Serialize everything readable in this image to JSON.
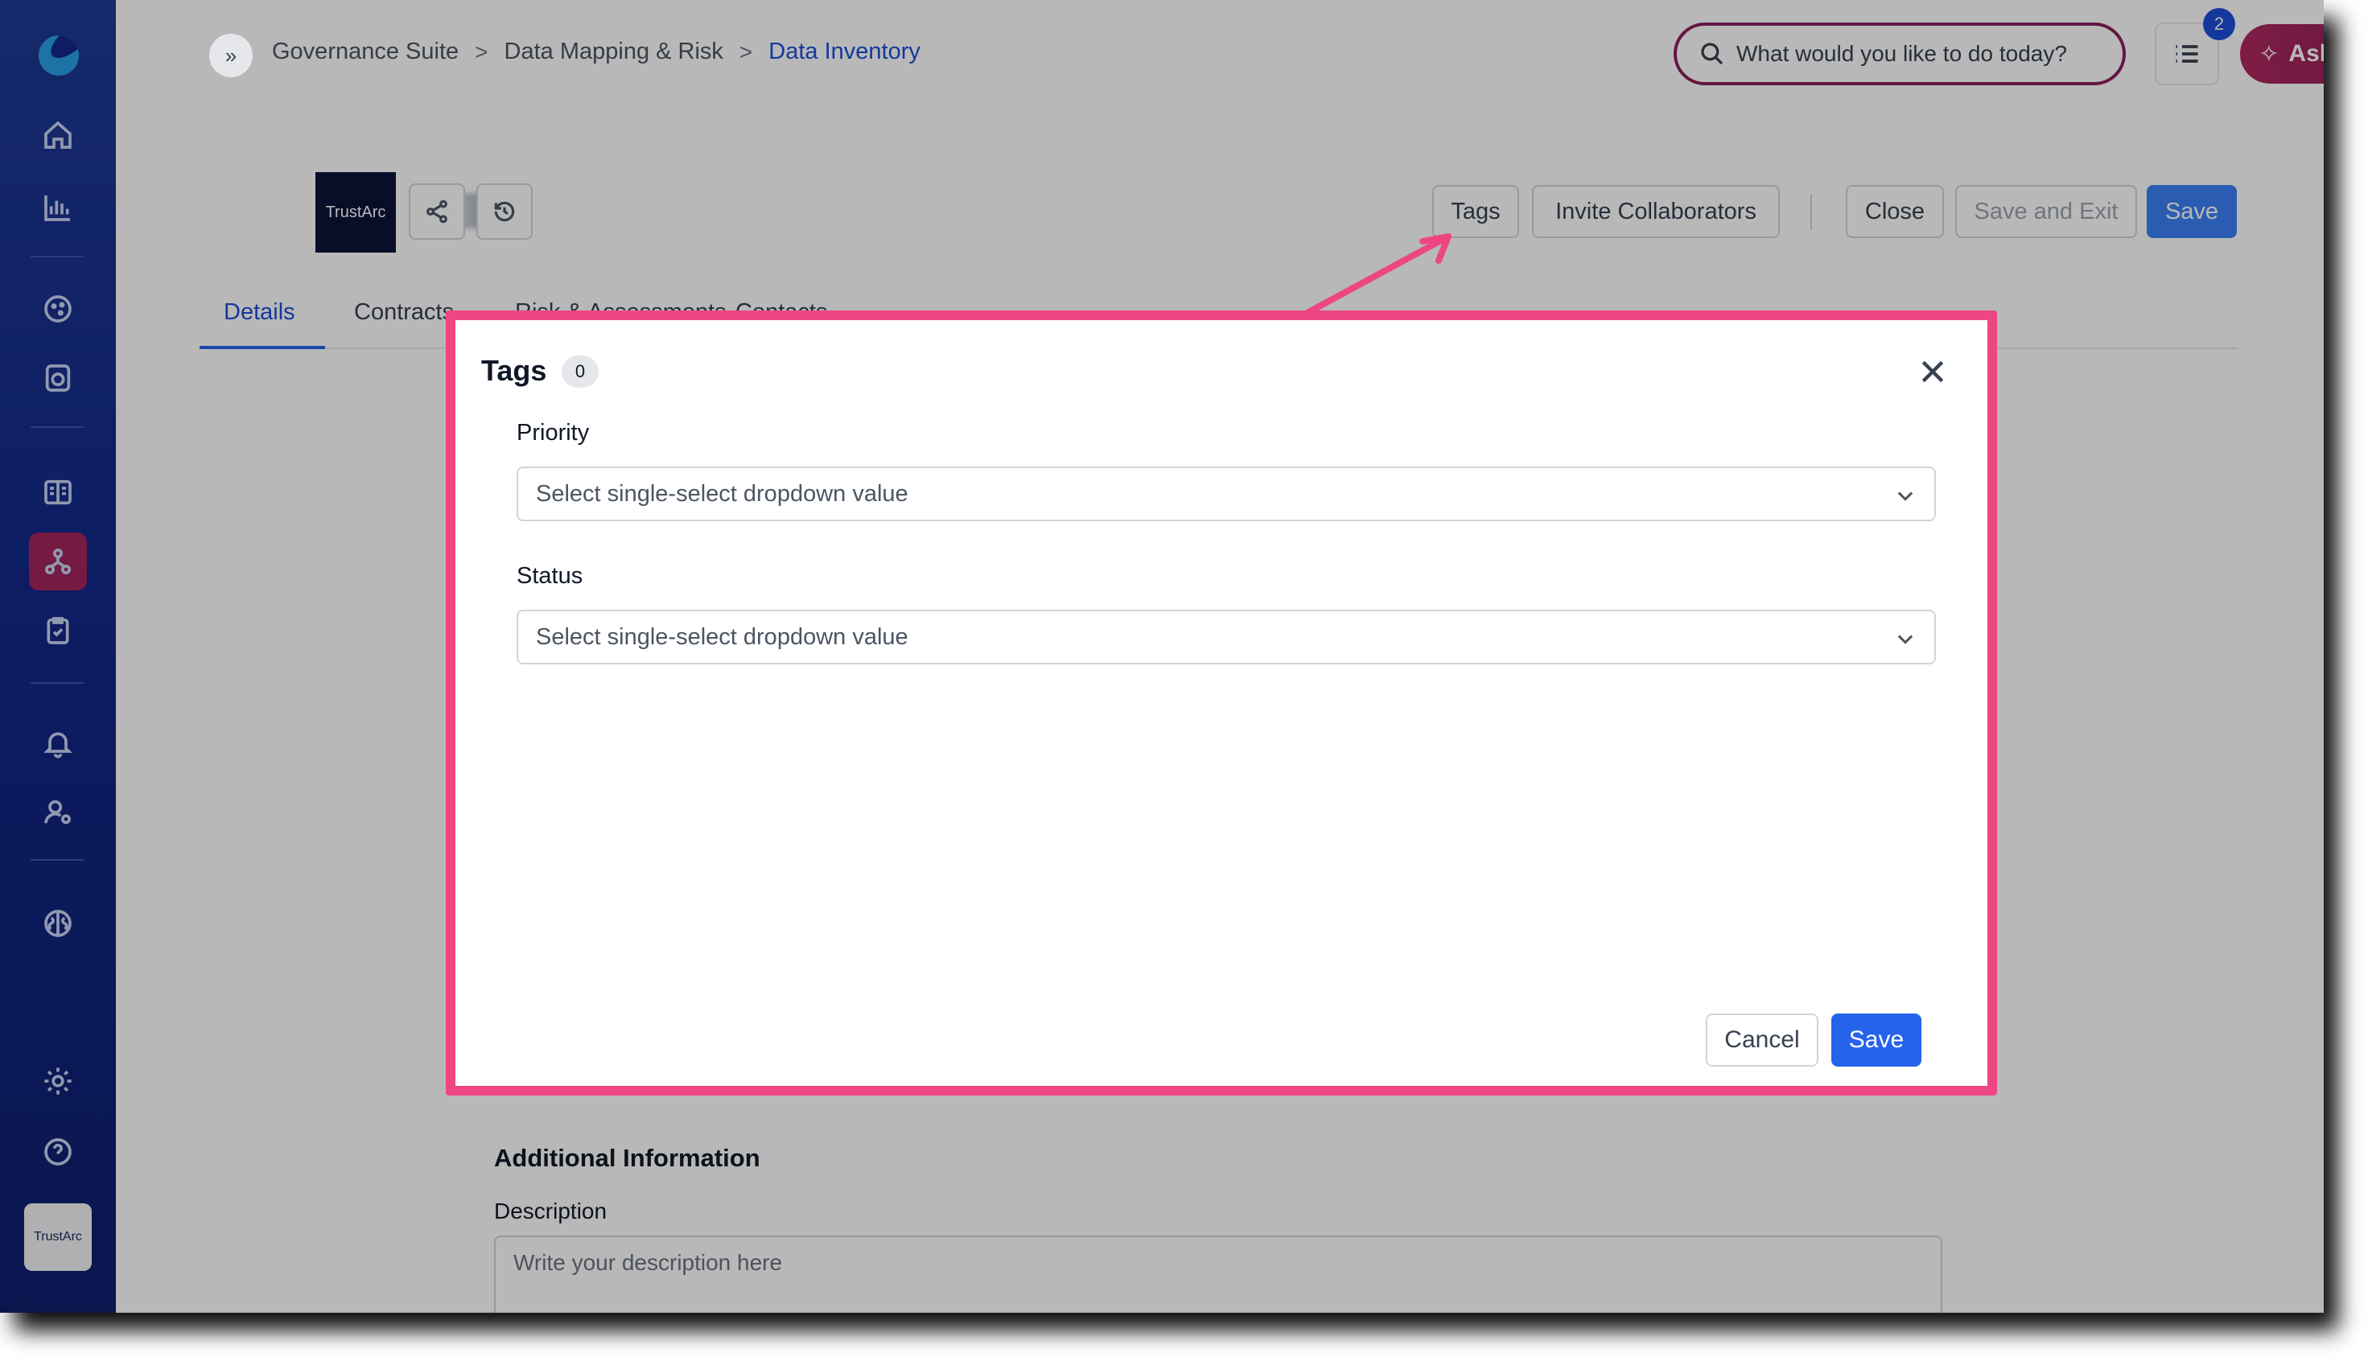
{
  "sidebar": {
    "icons": [
      "logo-icon",
      "home-icon",
      "analytics-icon",
      "cookie-icon",
      "consent-icon",
      "inventory-icon",
      "data-mapping-icon",
      "assessment-icon",
      "bell-icon",
      "user-settings-icon",
      "ai-brain-icon",
      "gear-icon",
      "help-icon"
    ],
    "org_logo": "TrustArc"
  },
  "breadcrumb": {
    "items": [
      "Governance Suite",
      "Data Mapping & Risk",
      "Data Inventory"
    ],
    "separator": ">"
  },
  "search": {
    "placeholder": "What would you like to do today?"
  },
  "notifications": {
    "count": "2"
  },
  "ask_arc": {
    "label": "Ask Arc"
  },
  "record": {
    "logo_text": "TrustArc"
  },
  "header_buttons": {
    "tags": "Tags",
    "invite": "Invite Collaborators",
    "close": "Close",
    "save_exit": "Save and Exit",
    "save": "Save"
  },
  "tabs": [
    "Details",
    "Contracts",
    "Risk & Assessments",
    "Contacts"
  ],
  "active_tab": "Details",
  "additional_info": {
    "title": "Additional Information",
    "description_label": "Description",
    "description_placeholder": "Write your description here"
  },
  "modal": {
    "title": "Tags",
    "count": "0",
    "fields": [
      {
        "label": "Priority",
        "placeholder": "Select single-select dropdown value"
      },
      {
        "label": "Status",
        "placeholder": "Select single-select dropdown value"
      }
    ],
    "cancel_label": "Cancel",
    "save_label": "Save"
  },
  "colors": {
    "accent": "#2563eb",
    "brand_magenta": "#8a1f5c",
    "annotation_pink": "#ee4683",
    "sidebar": "#12288a"
  }
}
